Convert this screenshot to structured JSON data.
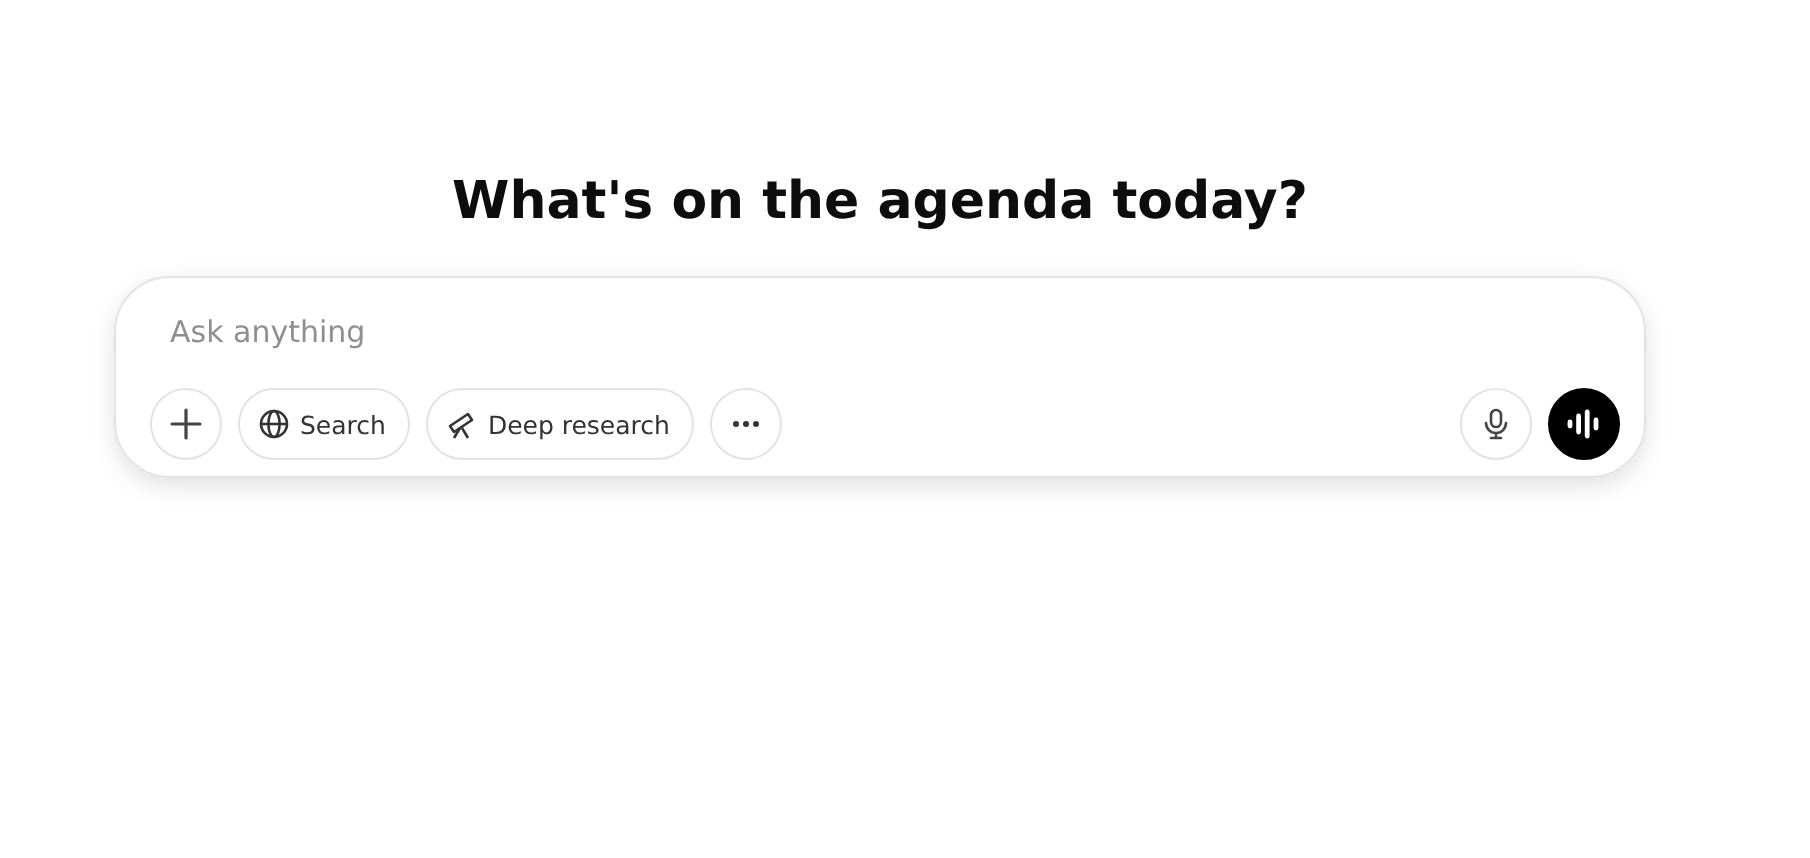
{
  "heading": "What's on the agenda today?",
  "composer": {
    "placeholder": "Ask anything",
    "tools": [
      {
        "kind": "plus"
      },
      {
        "kind": "globe",
        "label": "Search"
      },
      {
        "kind": "telescope",
        "label": "Deep research"
      },
      {
        "kind": "more"
      }
    ]
  }
}
